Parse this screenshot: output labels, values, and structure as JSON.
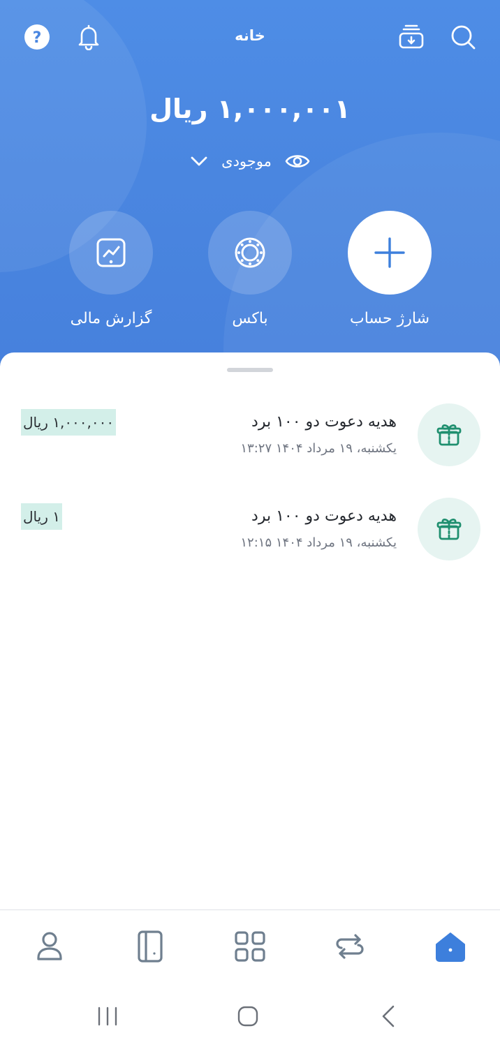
{
  "header": {
    "title": "خانه",
    "balance": "۱,۰۰۰,۰۰۱ ریال",
    "balance_label": "موجودی",
    "icons": [
      "help-icon",
      "bell-icon",
      "inbox-download-icon",
      "search-icon"
    ]
  },
  "actions": [
    {
      "label": "گزارش مالی",
      "icon": "chart-report-icon"
    },
    {
      "label": "باکس",
      "icon": "box-icon"
    },
    {
      "label": "شارژ حساب",
      "icon": "plus-icon"
    }
  ],
  "transactions": [
    {
      "title": "هدیه دعوت دو ۱۰۰ برد",
      "date": "یکشنبه، ۱۹ مرداد ۱۴۰۴ ۱۳:۲۷",
      "amount": "۱,۰۰۰,۰۰۰ ریال",
      "icon": "gift-icon"
    },
    {
      "title": "هدیه دعوت دو ۱۰۰ برد",
      "date": "یکشنبه، ۱۹ مرداد ۱۴۰۴ ۱۲:۱۵",
      "amount": "۱ ریال",
      "icon": "gift-icon"
    }
  ],
  "bottom_nav": {
    "items": [
      "profile-icon",
      "cards-icon",
      "services-grid-icon",
      "transfer-icon",
      "home-icon"
    ],
    "active": "home-icon"
  },
  "colors": {
    "header_blue": "#4a86e0",
    "accent_blue": "#3d7fdc",
    "gift_green": "#1f8f6f",
    "amount_highlight": "#d3efe9",
    "nav_icon_gray": "#6f7f8f"
  }
}
